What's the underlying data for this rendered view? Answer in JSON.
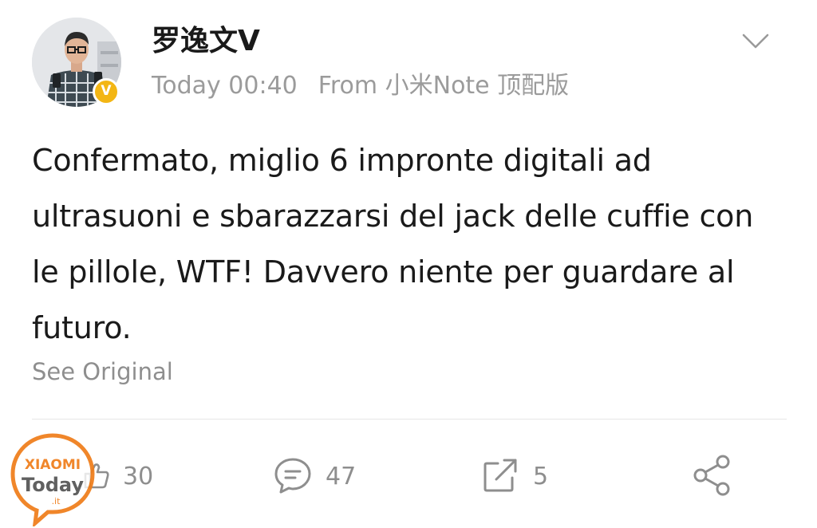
{
  "post": {
    "username": "罗逸文V",
    "timestamp": "Today 00:40",
    "source": "From 小米Note 顶配版",
    "verified_badge": "V",
    "content": "Confermato, miglio 6 impronte digitali ad ultrasuoni e sbarazzarsi del jack delle cuffie con le pillole, WTF! Davvero niente per guardare al futuro.",
    "see_original": "See Original"
  },
  "actions": {
    "like_count": "30",
    "comment_count": "47",
    "repost_count": "5"
  },
  "watermark": {
    "line1": "XIAOMI",
    "line2": "Today",
    "suffix": ".it"
  },
  "icons": {
    "menu": "chevron-down-icon",
    "like": "thumbs-up-icon",
    "comment": "comment-bubble-icon",
    "repost": "repost-arrow-icon",
    "share": "share-icon"
  },
  "colors": {
    "badge": "#f3b614",
    "muted_text": "#9b9b9b",
    "icon_gray": "#8e8e8e",
    "watermark_orange": "#ef7d1a"
  }
}
